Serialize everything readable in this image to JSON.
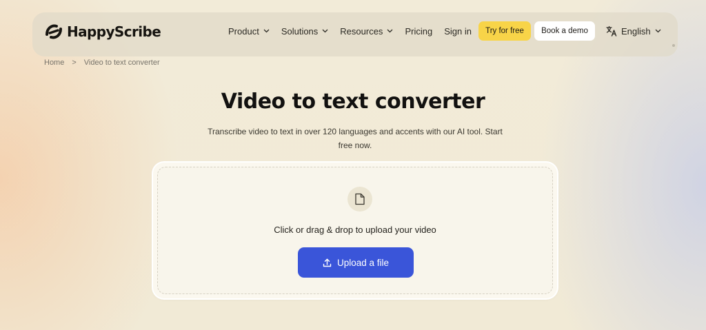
{
  "brand": {
    "name": "HappyScribe",
    "logo_icon": "happyscribe-logo-icon"
  },
  "nav": {
    "items": [
      {
        "label": "Product",
        "has_dropdown": true
      },
      {
        "label": "Solutions",
        "has_dropdown": true
      },
      {
        "label": "Resources",
        "has_dropdown": true
      },
      {
        "label": "Pricing",
        "has_dropdown": false
      },
      {
        "label": "Sign in",
        "has_dropdown": false
      }
    ],
    "try_label": "Try for free",
    "demo_label": "Book a demo",
    "language": "English",
    "language_icon": "translate-icon"
  },
  "breadcrumb": {
    "home": "Home",
    "separator": ">",
    "current": "Video to text converter"
  },
  "hero": {
    "title": "Video to text converter",
    "subtitle": "Transcribe video to text in over 120 languages and accents with our AI tool. Start free now."
  },
  "upload": {
    "icon": "file-icon",
    "prompt": "Click or drag & drop to upload your video",
    "button_label": "Upload a file",
    "button_icon": "upload-icon"
  },
  "colors": {
    "accent_yellow": "#f8d448",
    "upload_blue": "#3a55d9",
    "background": "#f1ead6"
  }
}
